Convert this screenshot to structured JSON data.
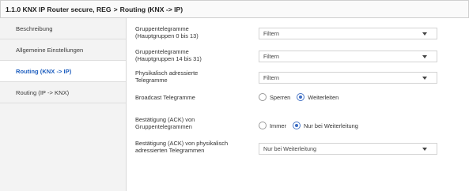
{
  "header": {
    "device": "1.1.0 KNX IP Router secure, REG",
    "separator": ">",
    "page": "Routing (KNX -> IP)"
  },
  "sidebar": {
    "items": [
      {
        "label": "Beschreibung",
        "active": false
      },
      {
        "label": "Allgemeine Einstellungen",
        "active": false
      },
      {
        "label": "Routing (KNX -> IP)",
        "active": true
      },
      {
        "label": "Routing (IP -> KNX)",
        "active": false
      }
    ]
  },
  "params": {
    "group_main_0_13": {
      "label_line1": "Gruppentelegramme",
      "label_line2": "(Hauptgruppen 0 bis 13)",
      "value": "Filtern"
    },
    "group_main_14_31": {
      "label_line1": "Gruppentelegramme",
      "label_line2": "(Hauptgruppen 14 bis 31)",
      "value": "Filtern"
    },
    "physical": {
      "label_line1": "Physikalisch adressierte",
      "label_line2": "Telegramme",
      "value": "Filtern"
    },
    "broadcast": {
      "label": "Broadcast Telegramme",
      "options": [
        {
          "label": "Sperren",
          "checked": false
        },
        {
          "label": "Weiterleiten",
          "checked": true
        }
      ]
    },
    "ack_group": {
      "label_line1": "Bestätigung (ACK) von",
      "label_line2": "Gruppentelegrammen",
      "options": [
        {
          "label": "Immer",
          "checked": false
        },
        {
          "label": "Nur bei Weiterleitung",
          "checked": true
        }
      ]
    },
    "ack_physical": {
      "label_line1": "Bestätigung (ACK) von physikalisch",
      "label_line2": "adressierten Telegrammen",
      "value": "Nur bei Weiterleitung"
    }
  },
  "colors": {
    "accent": "#1f5fbf",
    "sidebar_bg": "#f3f3f3",
    "radio_checked": "#3b6cc4"
  }
}
